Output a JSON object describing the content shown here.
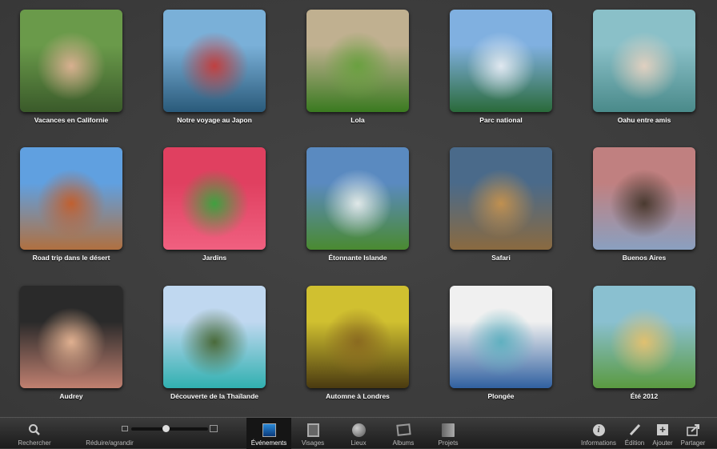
{
  "events": [
    {
      "label": "Vacances en Californie",
      "colors": [
        "#6a9a4a",
        "#d8b090",
        "#3a5a2a"
      ]
    },
    {
      "label": "Notre voyage au Japon",
      "colors": [
        "#7ab0d8",
        "#c04040",
        "#2a5a7a"
      ]
    },
    {
      "label": "Lola",
      "colors": [
        "#c0b090",
        "#6aa040",
        "#3a7a20"
      ]
    },
    {
      "label": "Parc national",
      "colors": [
        "#80b0e0",
        "#e0e8f0",
        "#2a6a3a"
      ]
    },
    {
      "label": "Oahu entre amis",
      "colors": [
        "#8ac0c8",
        "#e0d0c0",
        "#4a8a8a"
      ]
    },
    {
      "label": "Road trip dans le désert",
      "colors": [
        "#60a0e0",
        "#c06030",
        "#b07040"
      ]
    },
    {
      "label": "Jardins",
      "colors": [
        "#e04060",
        "#40a040",
        "#f06080"
      ]
    },
    {
      "label": "Étonnante Islande",
      "colors": [
        "#5a8ac0",
        "#e0e8e8",
        "#4a8a30"
      ]
    },
    {
      "label": "Safari",
      "colors": [
        "#4a6a8a",
        "#c09050",
        "#8a6a40"
      ]
    },
    {
      "label": "Buenos Aires",
      "colors": [
        "#c08080",
        "#4a3a30",
        "#8aa0c0"
      ]
    },
    {
      "label": "Audrey",
      "colors": [
        "#2a2a2a",
        "#e0b090",
        "#c08070"
      ]
    },
    {
      "label": "Découverte de la Thaïlande",
      "colors": [
        "#c0d8f0",
        "#4a6a3a",
        "#30b0b0"
      ]
    },
    {
      "label": "Automne à Londres",
      "colors": [
        "#d0c030",
        "#8a6a20",
        "#4a3a10"
      ]
    },
    {
      "label": "Plongée",
      "colors": [
        "#f0f0f0",
        "#60b0c0",
        "#3060a0"
      ]
    },
    {
      "label": "Été 2012",
      "colors": [
        "#8ac0d0",
        "#e0c070",
        "#5a9a40"
      ]
    }
  ],
  "toolbar": {
    "search": "Rechercher",
    "zoom": "Réduire/agrandir",
    "zoom_level": 0.45,
    "tabs": [
      "Événements",
      "Visages",
      "Lieux",
      "Albums",
      "Projets"
    ],
    "info": "Informations",
    "edit": "Édition",
    "add": "Ajouter",
    "share": "Partager"
  }
}
